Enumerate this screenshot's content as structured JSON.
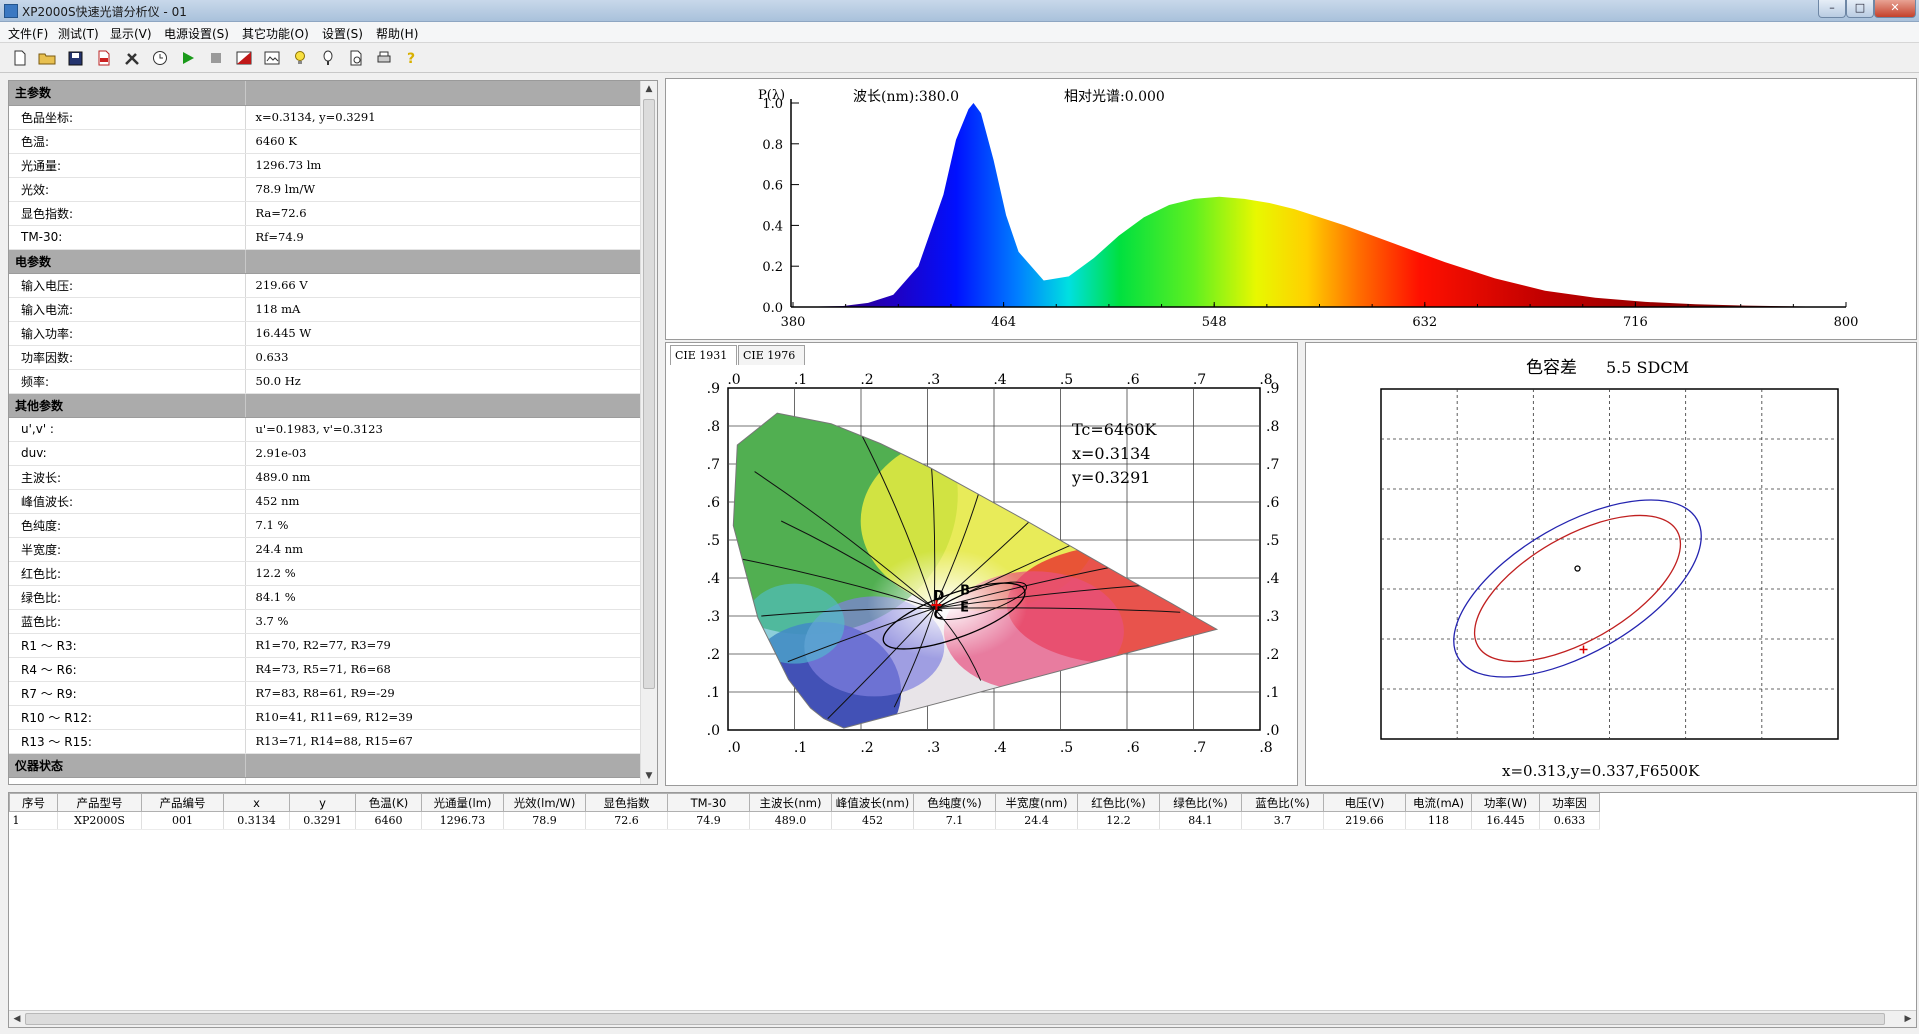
{
  "window": {
    "title": "XP2000S快速光谱分析仪 - 01"
  },
  "menu": [
    "文件(F)",
    "测试(T)",
    "显示(V)",
    "电源设置(S)",
    "其它功能(O)",
    "设置(S)",
    "帮助(H)"
  ],
  "toolbar_icons": [
    "new-file-icon",
    "open-folder-icon",
    "save-icon",
    "pdf-icon",
    "tools-icon",
    "clock-icon",
    "play-icon",
    "stop-icon",
    "chart-icon",
    "image-icon",
    "light-bulb-icon",
    "probe-icon",
    "preview-icon",
    "print-icon",
    "help-icon"
  ],
  "params": {
    "sections": [
      {
        "title": "主参数",
        "rows": [
          {
            "k": "色品坐标:",
            "v": "x=0.3134, y=0.3291"
          },
          {
            "k": "色温:",
            "v": "6460 K"
          },
          {
            "k": "光通量:",
            "v": "1296.73 lm"
          },
          {
            "k": "光效:",
            "v": "78.9 lm/W"
          },
          {
            "k": "显色指数:",
            "v": "Ra=72.6"
          },
          {
            "k": "TM-30:",
            "v": "Rf=74.9"
          }
        ]
      },
      {
        "title": "电参数",
        "rows": [
          {
            "k": "输入电压:",
            "v": "219.66 V"
          },
          {
            "k": "输入电流:",
            "v": "118 mA"
          },
          {
            "k": "输入功率:",
            "v": "16.445 W"
          },
          {
            "k": "功率因数:",
            "v": "0.633"
          },
          {
            "k": "频率:",
            "v": "50.0 Hz"
          }
        ]
      },
      {
        "title": "其他参数",
        "rows": [
          {
            "k": "u',v' :",
            "v": "u'=0.1983, v'=0.3123"
          },
          {
            "k": "duv:",
            "v": "2.91e-03"
          },
          {
            "k": "主波长:",
            "v": "489.0 nm"
          },
          {
            "k": "峰值波长:",
            "v": "452 nm"
          },
          {
            "k": "色纯度:",
            "v": "7.1 %"
          },
          {
            "k": "半宽度:",
            "v": "24.4 nm"
          },
          {
            "k": "红色比:",
            "v": "12.2 %"
          },
          {
            "k": "绿色比:",
            "v": "84.1 %"
          },
          {
            "k": "蓝色比:",
            "v": "3.7 %"
          },
          {
            "k": "R1 ～ R3:",
            "v": "R1=70,  R2=77,  R3=79"
          },
          {
            "k": "R4 ～ R6:",
            "v": "R4=73,  R5=71,  R6=68"
          },
          {
            "k": "R7 ～ R9:",
            "v": "R7=83,  R8=61,  R9=-29"
          },
          {
            "k": "R10 ～ R12:",
            "v": "R10=41, R11=69, R12=39"
          },
          {
            "k": "R13 ～ R15:",
            "v": "R13=71, R14=88, R15=67"
          }
        ]
      },
      {
        "title": "仪器状态",
        "rows": []
      }
    ]
  },
  "spectrum": {
    "ylabel": "P(λ)",
    "wavelength_label": "波长(nm):380.0",
    "relative_label": "相对光谱:0.000",
    "chart_data": {
      "type": "area",
      "x_ticks": [
        380,
        464,
        548,
        632,
        716,
        800
      ],
      "y_ticks": [
        "0.0",
        "0.2",
        "0.4",
        "0.6",
        "0.8",
        "1.0"
      ],
      "xlim": [
        380,
        800
      ],
      "ylim": [
        0,
        1.0
      ],
      "x": [
        380,
        400,
        410,
        420,
        430,
        440,
        445,
        450,
        452,
        455,
        460,
        465,
        470,
        480,
        490,
        500,
        510,
        520,
        530,
        540,
        550,
        560,
        570,
        580,
        590,
        600,
        620,
        640,
        660,
        680,
        700,
        720,
        740,
        760,
        780,
        800
      ],
      "y": [
        0.0,
        0.005,
        0.02,
        0.06,
        0.2,
        0.55,
        0.82,
        0.97,
        1.0,
        0.95,
        0.72,
        0.45,
        0.27,
        0.13,
        0.15,
        0.24,
        0.35,
        0.44,
        0.5,
        0.53,
        0.54,
        0.53,
        0.51,
        0.48,
        0.44,
        0.4,
        0.31,
        0.22,
        0.14,
        0.08,
        0.045,
        0.025,
        0.013,
        0.007,
        0.003,
        0.0
      ]
    }
  },
  "cie": {
    "tabs": [
      "CIE 1931",
      "CIE 1976"
    ],
    "x_ticks": [
      ".0",
      ".1",
      ".2",
      ".3",
      ".4",
      ".5",
      ".6",
      ".7",
      ".8"
    ],
    "y_ticks": [
      ".9",
      ".8",
      ".7",
      ".6",
      ".5",
      ".4",
      ".3",
      ".2",
      ".1",
      ".0"
    ],
    "tc_label": "Tc=6460K",
    "x_label": "x=0.3134",
    "y_label": "y=0.3291",
    "markers": [
      "D",
      "B",
      "C",
      "E"
    ],
    "point": {
      "x": 0.3134,
      "y": 0.3291
    }
  },
  "tolerance": {
    "title": "色容差",
    "value": "5.5 SDCM",
    "footer": "x=0.313,y=0.337,F6500K"
  },
  "results": {
    "headers": [
      "序号",
      "产品型号",
      "产品编号",
      "x",
      "y",
      "色温(K)",
      "光通量(lm)",
      "光效(lm/W)",
      "显色指数",
      "TM-30",
      "主波长(nm)",
      "峰值波长(nm)",
      "色纯度(%)",
      "半宽度(nm)",
      "红色比(%)",
      "绿色比(%)",
      "蓝色比(%)",
      "电压(V)",
      "电流(mA)",
      "功率(W)",
      "功率因"
    ],
    "rows": [
      [
        "1",
        "XP2000S",
        "001",
        "0.3134",
        "0.3291",
        "6460",
        "1296.73",
        "78.9",
        "72.6",
        "74.9",
        "489.0",
        "452",
        "7.1",
        "24.4",
        "12.2",
        "84.1",
        "3.7",
        "219.66",
        "118",
        "16.445",
        "0.633"
      ]
    ]
  }
}
